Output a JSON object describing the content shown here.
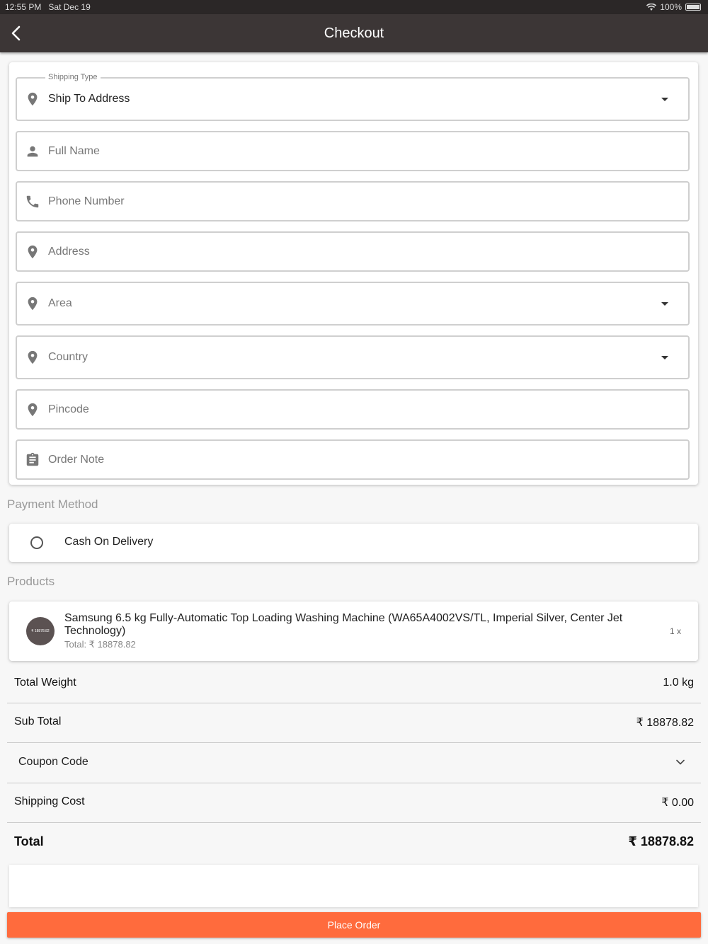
{
  "status_bar": {
    "time": "12:55 PM",
    "date": "Sat Dec 19",
    "battery": "100%"
  },
  "header": {
    "title": "Checkout",
    "back_icon": "chevron-left-icon"
  },
  "form": {
    "shipping_type": {
      "legend": "Shipping Type",
      "value": "Ship To Address",
      "icon": "location-pin-icon"
    },
    "full_name": {
      "placeholder": "Full Name",
      "icon": "person-icon"
    },
    "phone": {
      "placeholder": "Phone Number",
      "icon": "phone-icon"
    },
    "address": {
      "placeholder": "Address",
      "icon": "location-pin-icon"
    },
    "area": {
      "placeholder": "Area",
      "icon": "location-pin-icon"
    },
    "country": {
      "placeholder": "Country",
      "icon": "location-pin-icon"
    },
    "pincode": {
      "placeholder": "Pincode",
      "icon": "location-pin-icon"
    },
    "order_note": {
      "placeholder": "Order Note",
      "icon": "clipboard-icon"
    }
  },
  "payment": {
    "section_label": "Payment Method",
    "option_label": "Cash On Delivery"
  },
  "products": {
    "section_label": "Products",
    "items": [
      {
        "thumb_text": "₹ 18878.82",
        "name": "Samsung 6.5 kg Fully-Automatic Top Loading Washing Machine (WA65A4002VS/TL, Imperial Silver, Center Jet Technology)",
        "total": "Total: ₹ 18878.82",
        "qty": "1 x"
      }
    ]
  },
  "summary": {
    "weight_label": "Total Weight",
    "weight_value": "1.0 kg",
    "subtotal_label": "Sub Total",
    "subtotal_value": "₹ 18878.82",
    "coupon_label": "Coupon Code",
    "shipping_label": "Shipping Cost",
    "shipping_value": "₹ 0.00",
    "total_label": "Total",
    "total_value": "₹ 18878.82"
  },
  "actions": {
    "place_order": "Place Order"
  },
  "colors": {
    "appbar": "#3c3636",
    "accent": "#ff6b3d"
  }
}
